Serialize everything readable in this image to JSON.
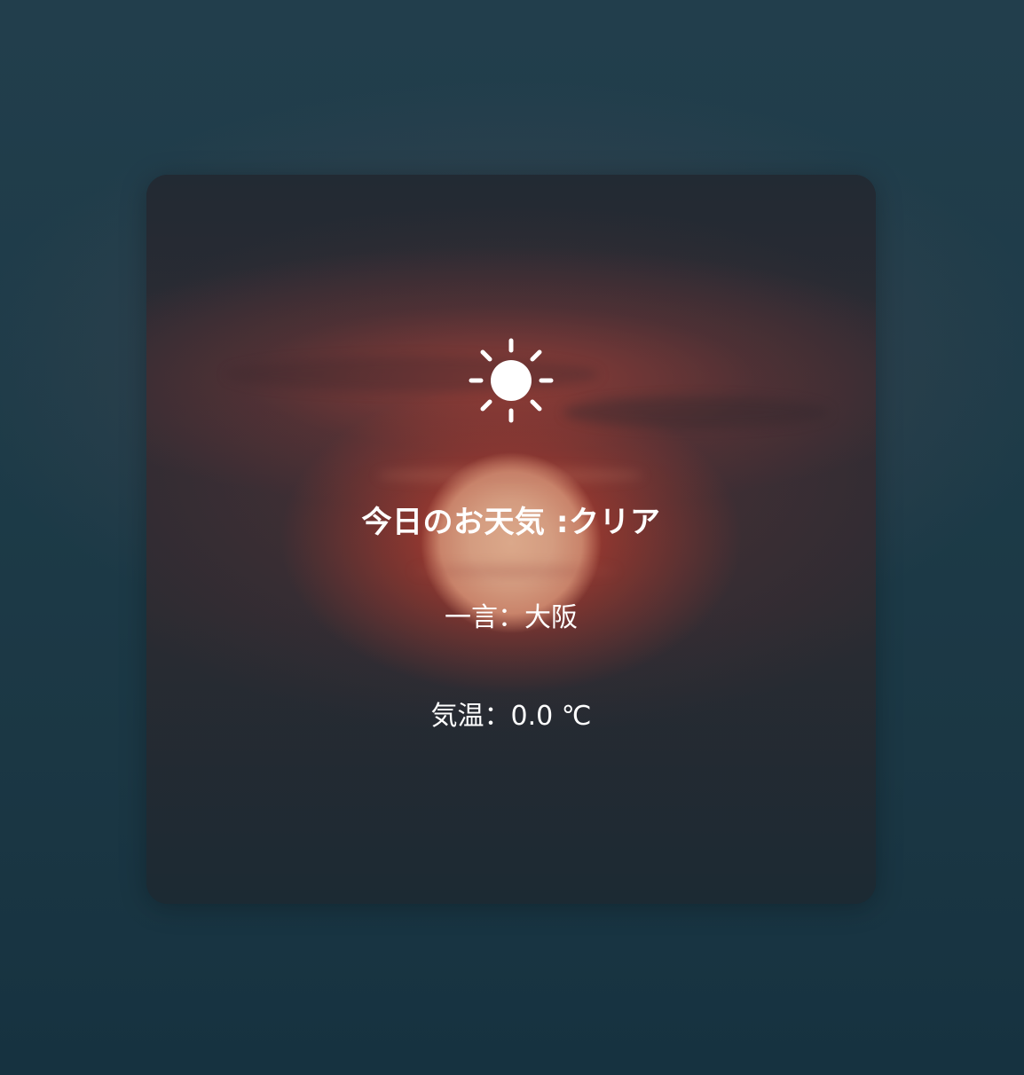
{
  "weather": {
    "icon": "sun-icon",
    "title": "今日のお天気 :クリア",
    "comment": "一言：大阪",
    "temperature": "気温：0.0 ℃"
  },
  "colors": {
    "text": "#ffffff",
    "card_base": "#1c242b",
    "page_background": "#1d3b48",
    "sun_glow": "#d64a32"
  }
}
